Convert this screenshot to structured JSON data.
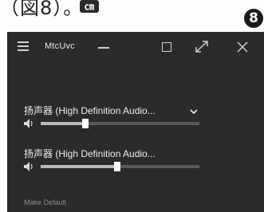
{
  "caption": {
    "text": "（図8）。",
    "icon_label": "㎝",
    "icon": "screenshot-icon"
  },
  "step_badge": "8",
  "window": {
    "title": "MtcUvc",
    "icons": {
      "menu": "hamburger-icon",
      "minimize": "minimize-icon",
      "maximize": "maximize-icon",
      "expand": "expand-icon",
      "close": "close-icon"
    }
  },
  "devices": [
    {
      "name": "扬声器 (High Definition Audio...",
      "has_dropdown": true,
      "volume": 0.28
    },
    {
      "name": "扬声器 (High Definition Audio...",
      "has_dropdown": false,
      "volume": 0.48
    }
  ],
  "make_default_label": "Make Default",
  "colors": {
    "window_bg": "#2b2b2b",
    "track": "#5a5a5a",
    "track_fill": "#b9b9b9",
    "thumb": "#ffffff"
  }
}
